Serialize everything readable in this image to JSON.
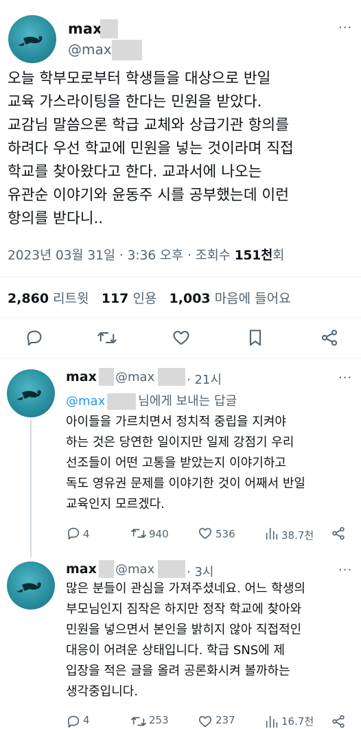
{
  "main_tweet": {
    "name": "max",
    "handle": "@max",
    "body": "오늘 학부모로부터 학생들을 대상으로 반일 교육 가스라이팅을 한다는 민원을 받았다. 교감님 말씀으론 학급 교체와 상급기관 항의를 하려다 우선 학교에 민원을 넣는 것이라며 직접 학교를 찾아왔다고 한다. 교과서에 나오는 유관순 이야기와 윤동주 시를 공부했는데 이런 항의를 받다니..",
    "body_lines": [
      "오늘 학부모로부터 학생들을 대상으로 반일",
      "교육 가스라이팅을 한다는 민원을 받았다.",
      "교감님 말씀으론 학급 교체와 상급기관 항의를",
      "하려다 우선 학교에 민원을 넣는 것이라며 직접",
      "학교를 찾아왔다고 한다. 교과서에 나오는",
      "유관순 이야기와 윤동주 시를 공부했는데 이런",
      "항의를 받다니.."
    ],
    "timestamp": "2023년 03월 31일 · 3:36 오후 · 조회수 ",
    "views": "151천",
    "views_suffix": "회",
    "retweets_count": "2,860",
    "retweets_label": "리트윗",
    "quotes_count": "117",
    "quotes_label": "인용",
    "likes_count": "1,003",
    "likes_label": "마음에 들어요"
  },
  "action_bar": {
    "icons": [
      "reply-icon",
      "retweet-icon",
      "like-icon",
      "bookmark-icon",
      "share-icon"
    ]
  },
  "replies": [
    {
      "name": "max",
      "handle": "@max",
      "time": "· 21시",
      "replying_to_handle": "@max",
      "replying_to_suffix": "님에게 보내는 답글",
      "lines": [
        "아이들을 가르치면서 정치적 중립을 지켜야",
        "하는 것은 당연한 일이지만 일제 강점기 우리",
        "선조들이 어떤 고통을 받았는지 이야기하고",
        "독도 영유권 문제를 이야기한 것이 어째서 반일",
        "교육인지 모르겠다."
      ],
      "reply_count": "4",
      "retweet_count": "940",
      "like_count": "536",
      "view_count": "38.7천"
    },
    {
      "name": "max",
      "handle": "@max",
      "time": "· 3시",
      "lines": [
        "많은 분들이 관심을 가져주셨네요. 어느 학생의",
        "부모님인지 짐작은 하지만 정작 학교에 찾아와",
        "민원을 넣으면서 본인을 밝히지 않아 직접적인",
        "대응이 어려운 상태입니다. 학급 SNS에 제",
        "입장을 적은 글을 올려 공론화시켜 볼까하는",
        "생각중입니다."
      ],
      "reply_count": "4",
      "retweet_count": "253",
      "like_count": "237",
      "view_count": "16.7천"
    }
  ],
  "colors": {
    "accent": "#1d9bf0",
    "secondary_text": "#536471",
    "divider": "#eff3f4"
  }
}
